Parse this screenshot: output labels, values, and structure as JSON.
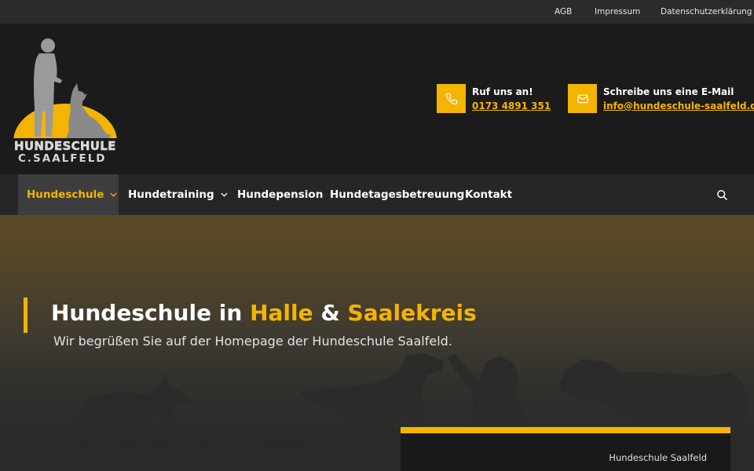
{
  "topbar": {
    "links": [
      {
        "label": "AGB"
      },
      {
        "label": "Impressum"
      },
      {
        "label": "Datenschutzerklärung"
      }
    ]
  },
  "logo": {
    "line1": "HUNDESCHULE",
    "line2": "C.SAALFELD"
  },
  "contact": {
    "phone": {
      "title": "Ruf uns an!",
      "value": "0173 4891 351",
      "icon": "phone-icon"
    },
    "email": {
      "title": "Schreibe uns eine E-Mail",
      "value": "info@hundeschule-saalfeld.de",
      "icon": "mail-icon"
    }
  },
  "nav": {
    "items": [
      {
        "label": "Hundeschule",
        "active": true,
        "dropdown": true
      },
      {
        "label": "Hundetraining",
        "dropdown": true
      },
      {
        "label": "Hundepension"
      },
      {
        "label": "Hundetagesbetreuung"
      },
      {
        "label": "Kontakt"
      }
    ],
    "search_icon": "search-icon"
  },
  "hero": {
    "title_part1": "Hundeschule in ",
    "title_part2": "Halle",
    "title_part3": " & ",
    "title_part4": "Saalekreis",
    "subtitle": "Wir begrüßen Sie auf der Homepage der Hundeschule Saalfeld.",
    "caption": "Hundeschule Saalfeld"
  },
  "colors": {
    "accent": "#f4b400",
    "background": "#1b1b1b",
    "nav_background": "#262626",
    "topbar_background": "#2b2b2b"
  }
}
